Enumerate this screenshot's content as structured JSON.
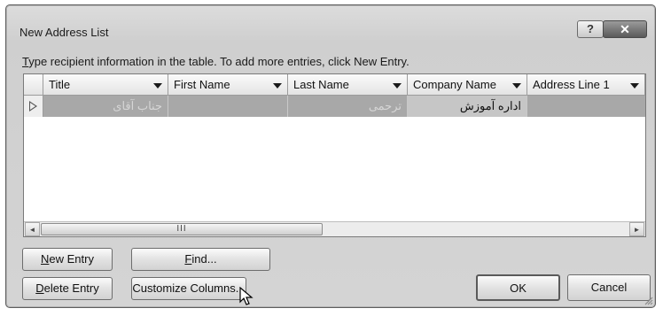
{
  "window": {
    "title": "New Address List",
    "help_label": "?",
    "close_label": "✕"
  },
  "instruction": {
    "first": "T",
    "rest": "ype recipient information in the table.  To add more entries, click New Entry."
  },
  "columns": [
    {
      "label": "Title"
    },
    {
      "label": "First Name"
    },
    {
      "label": "Last Name"
    },
    {
      "label": "Company Name"
    },
    {
      "label": "Address Line 1"
    }
  ],
  "rows": [
    {
      "title": "جناب آقای",
      "first_name": "",
      "last_name": "ترحمی",
      "company_name": "اداره آموزش",
      "address_line_1": ""
    }
  ],
  "scrollbar": {
    "left_arrow": "◄",
    "right_arrow": "►",
    "thumb_grip": "III"
  },
  "buttons": {
    "new_entry": {
      "first": "N",
      "rest": "ew Entry"
    },
    "find": {
      "first": "F",
      "rest": "ind..."
    },
    "delete_entry": {
      "first": "D",
      "rest": "elete Entry"
    },
    "customize_columns": {
      "label": "Customize Columns..."
    },
    "ok": {
      "label": "OK"
    },
    "cancel": {
      "label": "Cancel"
    }
  }
}
